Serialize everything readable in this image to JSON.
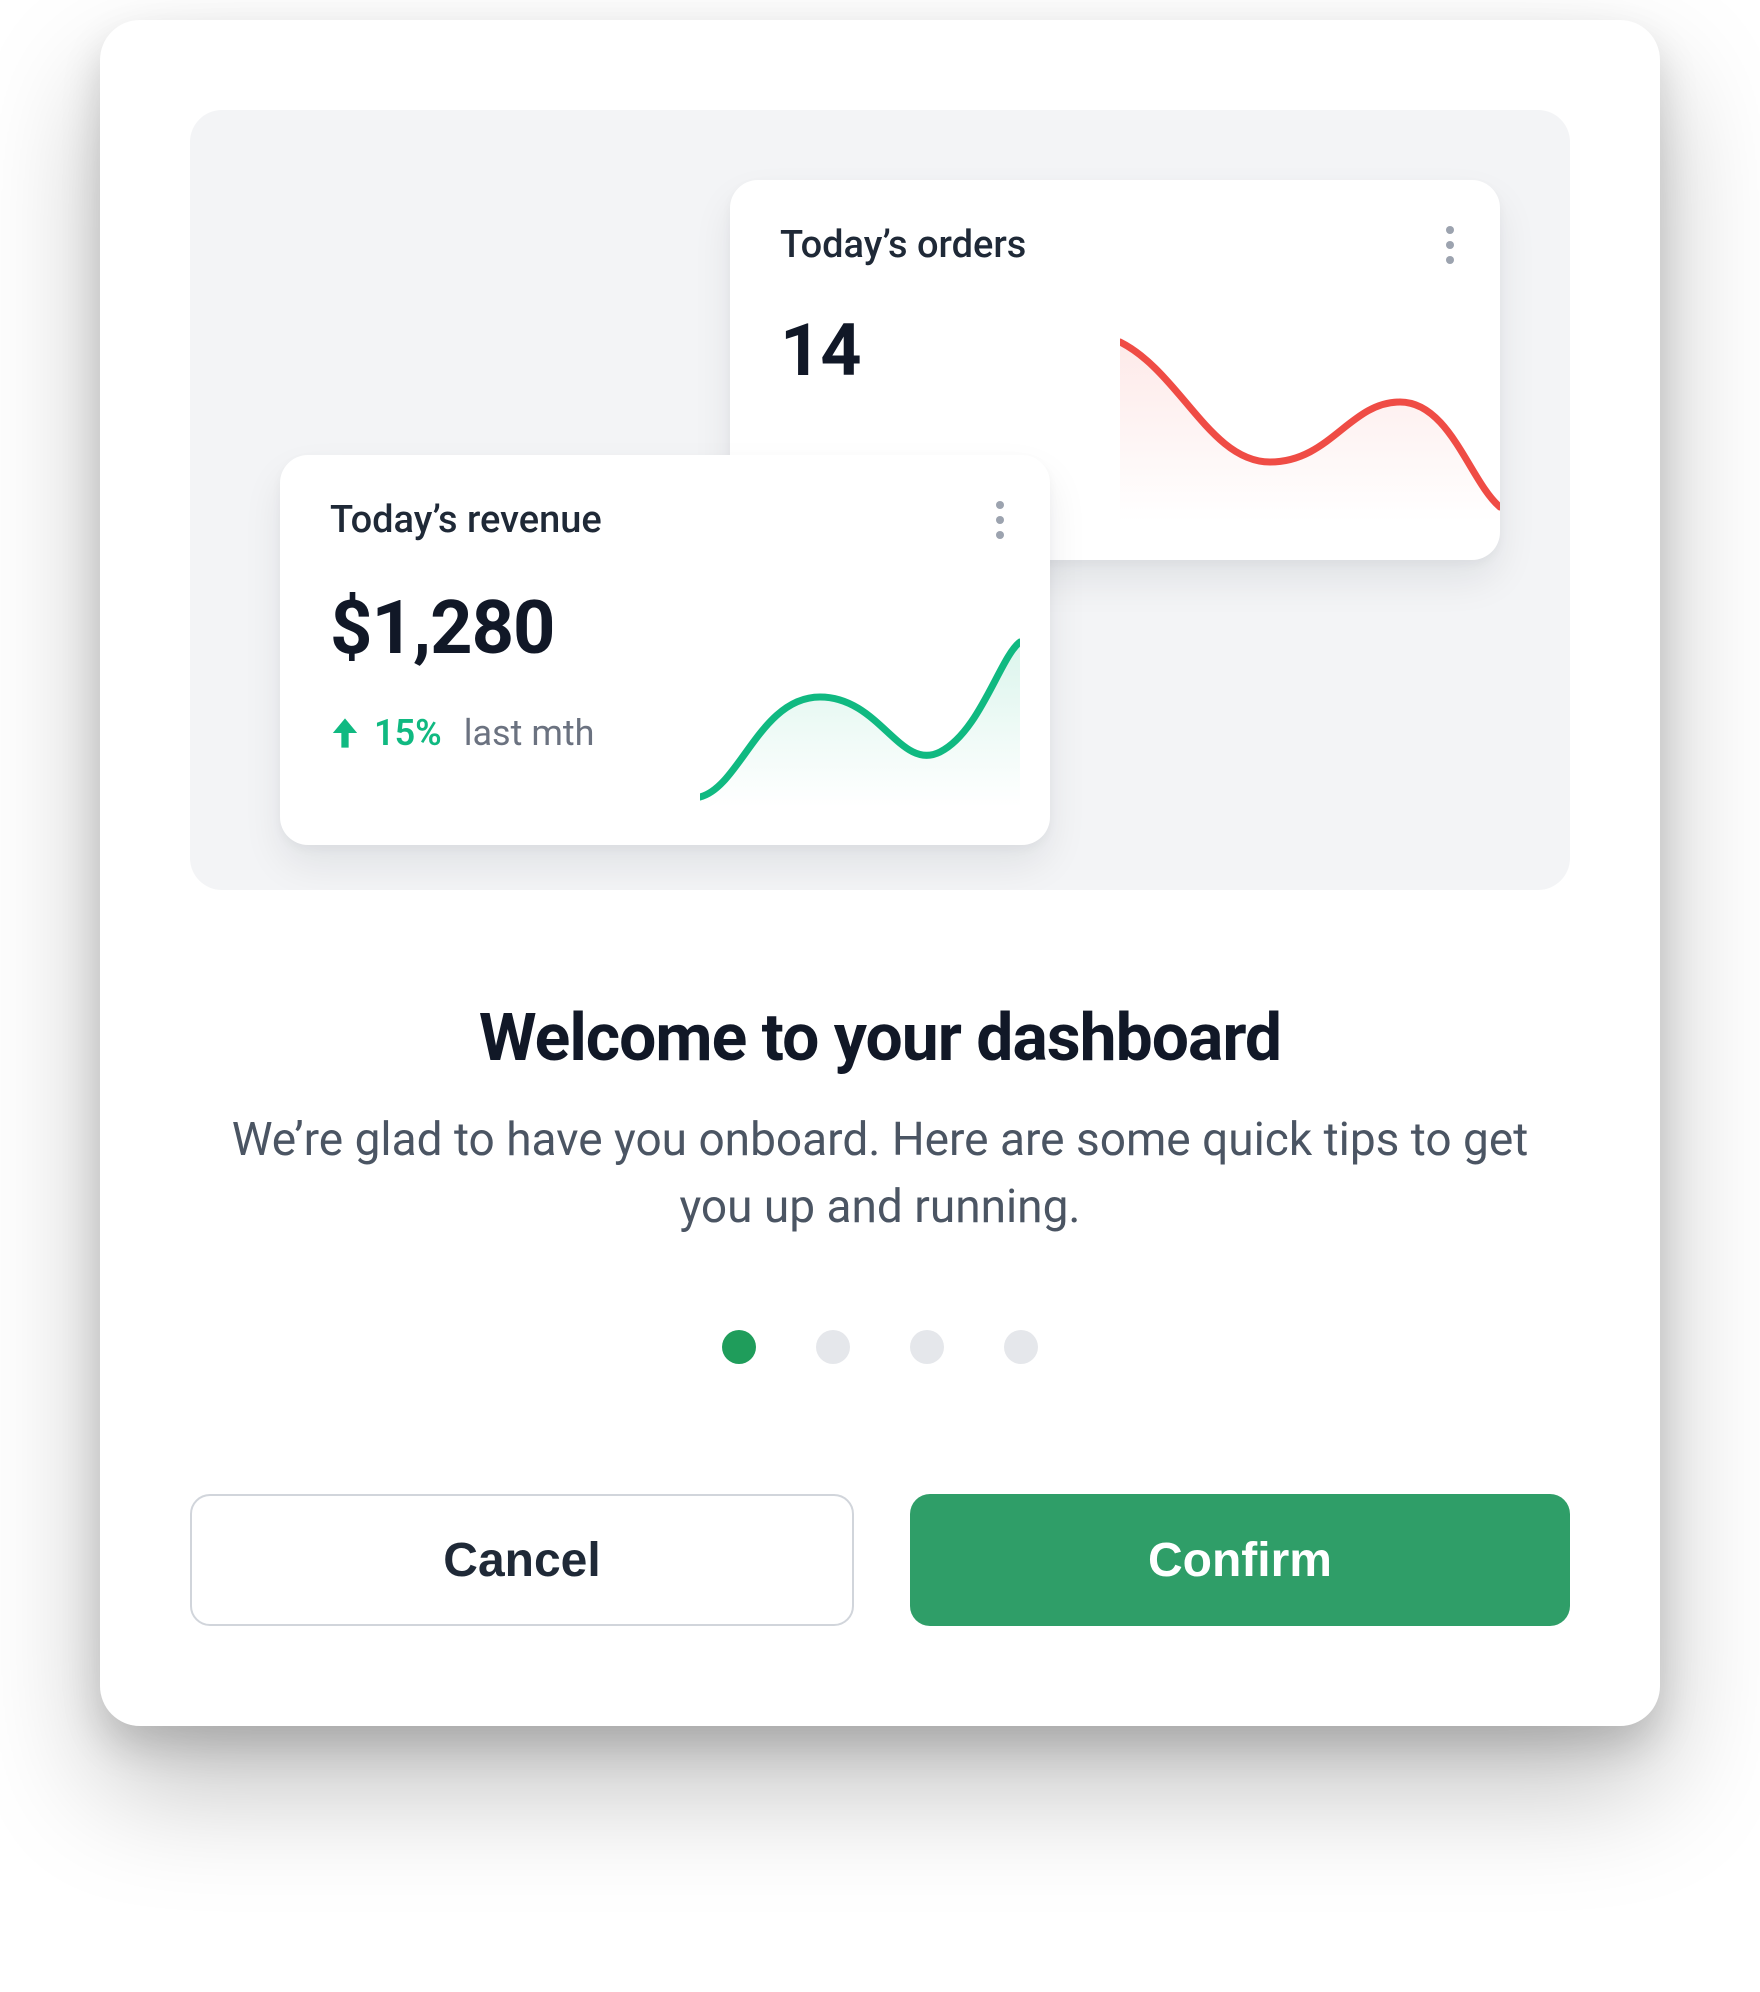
{
  "cards": {
    "orders": {
      "title": "Today’s orders",
      "value": "14"
    },
    "revenue": {
      "title": "Today’s revenue",
      "value": "$1,280",
      "trend_pct": "15%",
      "trend_label": "last mth"
    }
  },
  "headline": "Welcome to your dashboard",
  "subtext": "We’re glad to have you onboard. Here are some quick tips to get you up and running.",
  "pager": {
    "count": 4,
    "active": 0
  },
  "actions": {
    "cancel": "Cancel",
    "confirm": "Confirm"
  },
  "colors": {
    "green": "#10B981",
    "red": "#EF4C45",
    "primary": "#2F9E68"
  }
}
